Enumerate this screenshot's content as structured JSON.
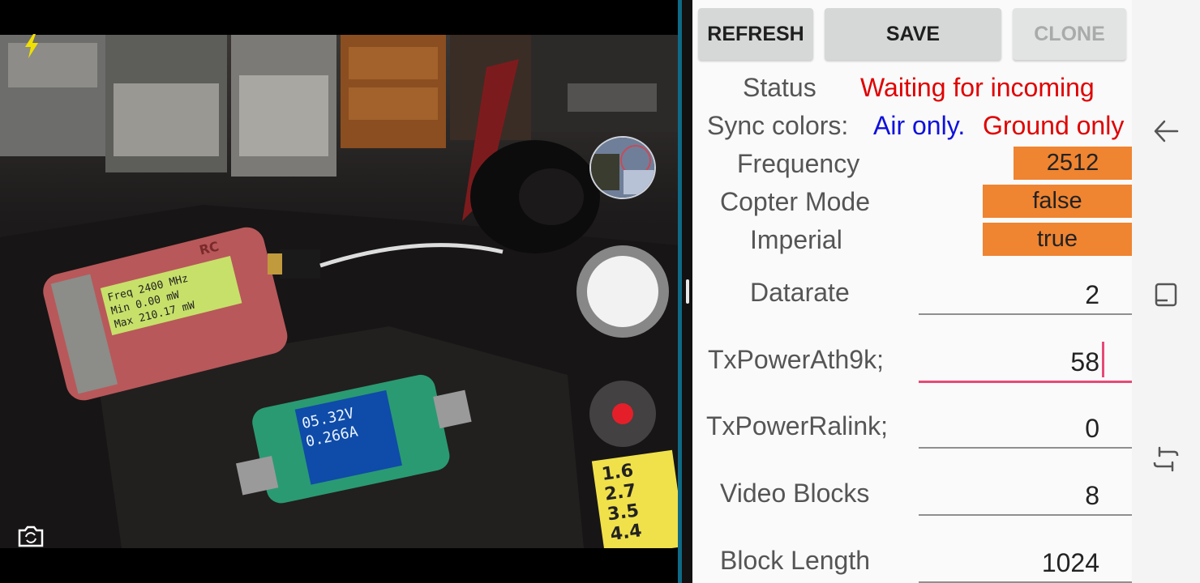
{
  "settings": {
    "buttons": {
      "refresh": "REFRESH",
      "save": "SAVE",
      "clone": "CLONE"
    },
    "status": {
      "label": "Status",
      "value": "Waiting for incoming"
    },
    "sync_colors": {
      "label": "Sync colors:",
      "air": "Air only.",
      "ground": "Ground only"
    },
    "frequency": {
      "label": "Frequency",
      "value": "2512"
    },
    "copter_mode": {
      "label": "Copter Mode",
      "value": "false"
    },
    "imperial": {
      "label": "Imperial",
      "value": "true"
    },
    "datarate": {
      "label": "Datarate",
      "value": "2"
    },
    "tx_power_ath9k": {
      "label": "TxPowerAth9k;",
      "value": "58"
    },
    "tx_power_ralink": {
      "label": "TxPowerRalink;",
      "value": "0"
    },
    "video_blocks": {
      "label": "Video Blocks",
      "value": "8"
    },
    "block_length": {
      "label": "Block Length",
      "value": "1024"
    }
  },
  "camera": {
    "lcd_lines": [
      "Freq 2400 MHz",
      "Min  0.00 mW",
      "Max  210.17 mW"
    ],
    "meter_lines": [
      "05.32V",
      "0.266A"
    ],
    "brand": "RC",
    "tag_lines": [
      "1.6",
      "2.7",
      "3.5",
      "4.4"
    ]
  },
  "icons": {
    "flash": "flash-icon",
    "switch_camera": "switch-camera-icon",
    "back": "back-icon",
    "home": "home-icon",
    "recents": "recents-icon"
  },
  "colors": {
    "accent": "#e64a76",
    "orange": "#ef8431",
    "status_red": "#e00000",
    "air_blue": "#1010dd"
  }
}
